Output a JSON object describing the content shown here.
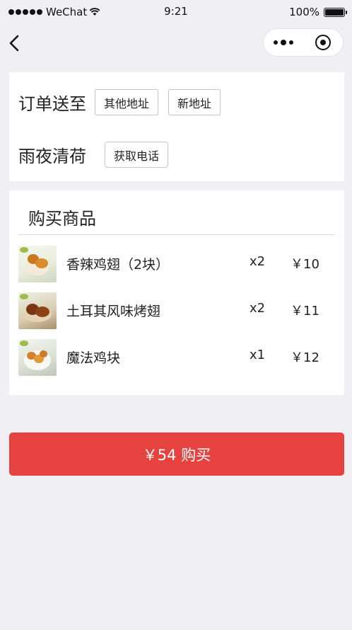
{
  "status_bar": {
    "carrier": "WeChat",
    "time": "9:21",
    "battery": "100%"
  },
  "nav": {
    "back_icon": "chevron-left-icon",
    "menu_icon": "more-dots-icon",
    "close_icon": "target-close-icon"
  },
  "address": {
    "deliver_to_label": "订单送至",
    "other_address_button": "其他地址",
    "new_address_button": "新地址",
    "recipient_name": "雨夜清荷",
    "get_phone_button": "获取电话"
  },
  "goods": {
    "title": "购买商品",
    "items": [
      {
        "name": "香辣鸡翅（2块）",
        "qty": "x2",
        "price": "￥10"
      },
      {
        "name": "土耳其风味烤翅",
        "qty": "x2",
        "price": "￥11"
      },
      {
        "name": "魔法鸡块",
        "qty": "x1",
        "price": "￥12"
      }
    ]
  },
  "buy_button": "￥54 购买",
  "colors": {
    "accent": "#e64340",
    "page_bg": "#efeff4",
    "card_bg": "#ffffff"
  }
}
